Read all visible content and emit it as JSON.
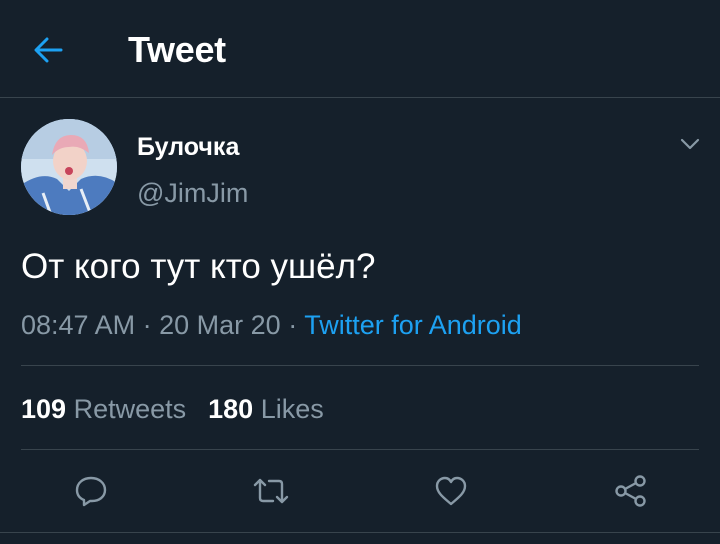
{
  "colors": {
    "background": "#15202b",
    "accent": "#1da1f2",
    "muted": "#8899a6",
    "divider": "#38444d"
  },
  "header": {
    "back_icon": "arrow-left-icon",
    "title": "Tweet"
  },
  "tweet": {
    "author": {
      "display_name": "Булочка",
      "handle": "@JimJim"
    },
    "menu_icon": "chevron-down-icon",
    "text": "От кого тут кто ушёл?",
    "time": "08:47 AM",
    "separator": "·",
    "date": "20 Mar 20",
    "source": "Twitter for Android"
  },
  "stats": {
    "retweets_count": "109",
    "retweets_label": "Retweets",
    "likes_count": "180",
    "likes_label": "Likes"
  },
  "actions": [
    {
      "icon": "reply-icon"
    },
    {
      "icon": "retweet-icon"
    },
    {
      "icon": "heart-icon"
    },
    {
      "icon": "share-icon"
    }
  ]
}
